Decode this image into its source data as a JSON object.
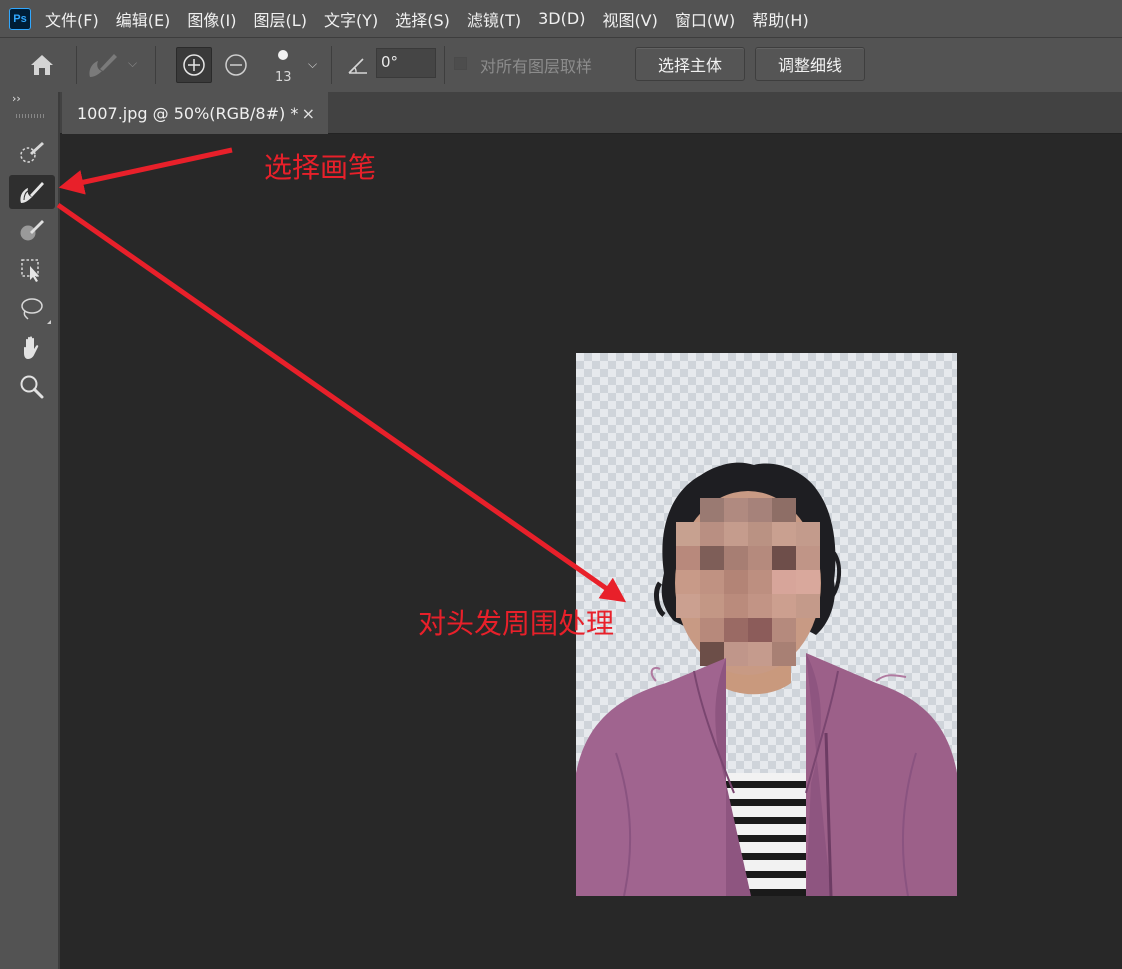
{
  "app": {
    "logo": "Ps"
  },
  "menu": [
    "文件(F)",
    "编辑(E)",
    "图像(I)",
    "图层(L)",
    "文字(Y)",
    "选择(S)",
    "滤镜(T)",
    "3D(D)",
    "视图(V)",
    "窗口(W)",
    "帮助(H)"
  ],
  "options": {
    "home_icon": "home-icon",
    "brush_preset_icon": "quick-selection-brush-icon",
    "add_mode_icon": "add-to-selection-icon",
    "subtract_mode_icon": "subtract-from-selection-icon",
    "brush_size": "13",
    "angle_value": "0°",
    "sample_all_layers_label": "对所有图层取样",
    "sample_all_layers_checked": false,
    "select_subject_label": "选择主体",
    "refine_hair_label": "调整细线"
  },
  "toolbar": {
    "collapse_label": "››",
    "active_tool": "refine-edge-brush-tool",
    "tools": [
      "quick-selection-tool",
      "refine-edge-brush-tool",
      "brush-tool",
      "object-selection-tool",
      "lasso-tool",
      "hand-tool",
      "zoom-tool"
    ]
  },
  "document": {
    "tab_title": "1007.jpg @ 50%(RGB/8#) *",
    "close_glyph": "×"
  },
  "annotations": {
    "label_1": "选择画笔",
    "label_2": "对头发周围处理"
  },
  "colors": {
    "annotation_red": "#e8202a",
    "jacket": "#a0648f",
    "ui_panel": "#535353",
    "canvas_bg": "#282828"
  }
}
